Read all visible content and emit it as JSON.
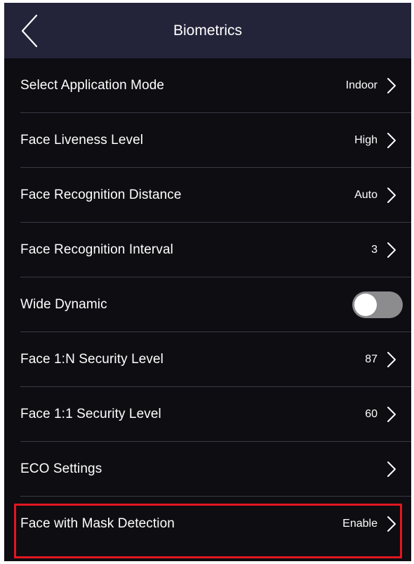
{
  "header": {
    "title": "Biometrics"
  },
  "rows": [
    {
      "label": "Select Application Mode",
      "value": "Indoor"
    },
    {
      "label": "Face Liveness Level",
      "value": "High"
    },
    {
      "label": "Face Recognition Distance",
      "value": "Auto"
    },
    {
      "label": "Face Recognition Interval",
      "value": "3"
    },
    {
      "label": "Wide Dynamic",
      "toggle_on": false
    },
    {
      "label": "Face 1:N Security Level",
      "value": "87"
    },
    {
      "label": "Face 1:1 Security Level",
      "value": "60"
    },
    {
      "label": "ECO Settings",
      "value": ""
    },
    {
      "label": "Face with Mask Detection",
      "value": "Enable",
      "highlighted": true
    }
  ],
  "colors": {
    "header_bg": "#23243a",
    "screen_bg": "#0d0d12",
    "highlight_border": "#e3161f",
    "toggle_off": "#8c8c8f"
  }
}
